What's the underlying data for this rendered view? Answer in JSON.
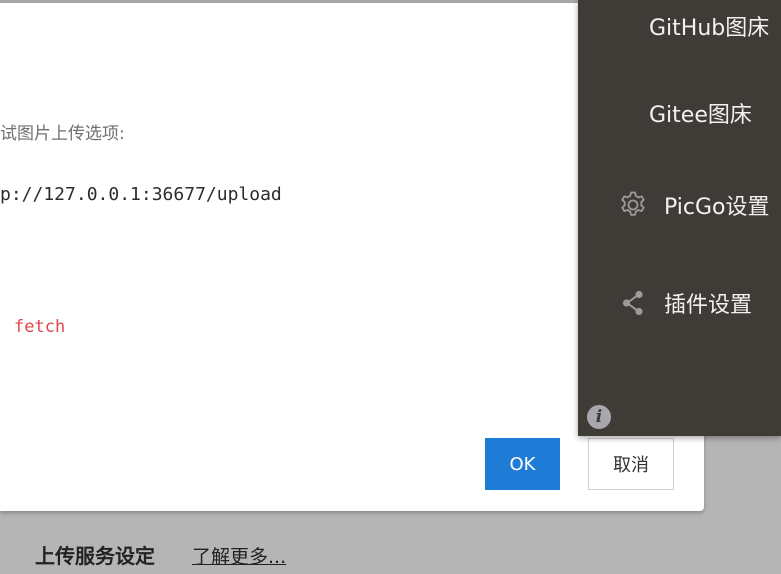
{
  "dialog": {
    "description": "试图片上传选项:",
    "url": "p://127.0.0.1:36677/upload",
    "code": "fetch",
    "ok_label": "OK",
    "cancel_label": "取消"
  },
  "side_menu": {
    "items": [
      {
        "label": "GitHub图床",
        "icon": null
      },
      {
        "label": "Gitee图床",
        "icon": null
      },
      {
        "label": "PicGo设置",
        "icon": "gear-icon"
      },
      {
        "label": "插件设置",
        "icon": "share-icon"
      }
    ],
    "info_icon": "i",
    "background": "#3f3b36"
  },
  "section": {
    "title": "上传服务设定",
    "link": "了解更多..."
  },
  "colors": {
    "primary": "#1e7bd6",
    "code": "#e0464a"
  }
}
